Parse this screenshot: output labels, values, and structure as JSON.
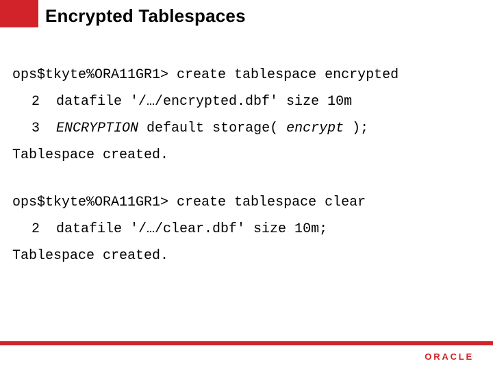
{
  "title": "Encrypted Tablespaces",
  "code": {
    "block1": {
      "prompt": "ops$tkyte%ORA11GR1> create tablespace encrypted",
      "l2_num": "2",
      "l2_txt": "  datafile '/…/encrypted.dbf' size 10m",
      "l3_num": "3",
      "l3_pre": "  ",
      "l3_kw1": "ENCRYPTION",
      "l3_mid": " default storage( ",
      "l3_kw2": "encrypt",
      "l3_post": " );",
      "result": "Tablespace created."
    },
    "block2": {
      "prompt": "ops$tkyte%ORA11GR1> create tablespace clear",
      "l2_num": "2",
      "l2_txt": "  datafile '/…/clear.dbf' size 10m;",
      "result": "Tablespace created."
    }
  },
  "brand": "ORACLE"
}
